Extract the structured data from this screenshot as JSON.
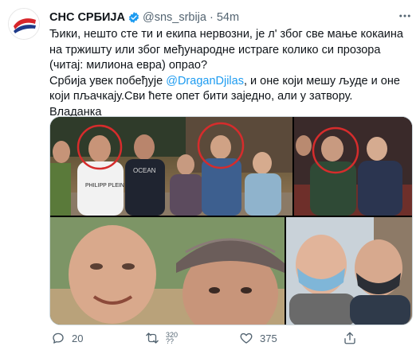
{
  "tweet": {
    "display_name": "СНС СРБИЈА",
    "handle": "@sns_srbija",
    "separator": "·",
    "time": "54m",
    "text": {
      "line1": "Ђики, нешто сте ти и екипа нервозни, је л' због све мање кокаина на тржишту или због међународне истраге колико си прозора (читај: милиона евра) опрао?",
      "line2_before": "Србија увек побеђује ",
      "mention": "@DraganDjilas",
      "line2_after": ", и оне који мешу људе и оне који пљачкају.Сви ћете опет бити заједно, али у затвору.",
      "signature": "Владанка"
    },
    "media": {
      "photo1_shirt_text_1": "PHILIPP PLEIN",
      "photo1_shirt_text_2": "OCEAN"
    },
    "actions": {
      "reply_count": "20",
      "retweet_count": "320 ??",
      "like_count": "375"
    }
  },
  "colors": {
    "accent": "#1d9bf0",
    "secondary_text": "#536471",
    "brand_red": "#d7262b",
    "circle_red": "#d62c2c"
  },
  "icons": {
    "avatar": "sns-logo-icon",
    "verified": "verified-badge-icon",
    "more": "more-icon",
    "reply": "reply-icon",
    "retweet": "retweet-icon",
    "like": "like-icon",
    "share": "share-icon"
  }
}
